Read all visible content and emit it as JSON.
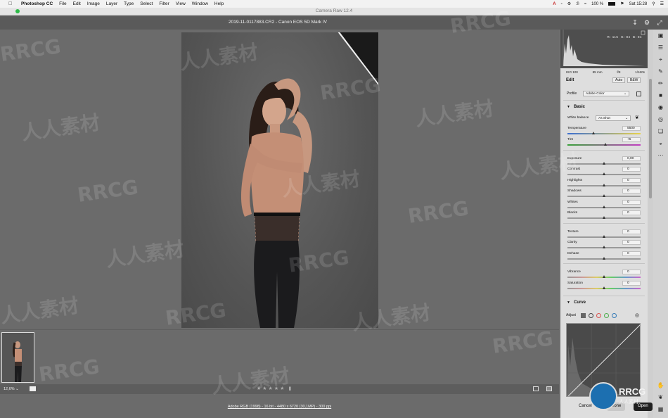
{
  "menubar": {
    "app": "Photoshop CC",
    "items": [
      "File",
      "Edit",
      "Image",
      "Layer",
      "Type",
      "Select",
      "Filter",
      "View",
      "Window",
      "Help"
    ],
    "battery": "100 %",
    "clock": "Sat 15:28"
  },
  "dialog": {
    "title": "Camera Raw 12.4"
  },
  "file_info": "2019-11-0117883.CR2  -  Canon EOS 5D Mark IV",
  "histogram": {
    "r": "R: 115",
    "g": "G: 84",
    "b": "B: 84"
  },
  "exif": [
    "ISO 100",
    "85 mm",
    "f/8",
    "1/160s"
  ],
  "edit": {
    "label": "Edit",
    "auto": "Auto",
    "bw": "B&W"
  },
  "profile": {
    "label": "Profile",
    "value": "Adobe Color"
  },
  "basic": {
    "title": "Basic",
    "white_balance_label": "White balance",
    "white_balance_value": "As Shot",
    "sliders": [
      {
        "label": "Temperature",
        "value": "5500",
        "pos": 0.36
      },
      {
        "label": "Tint",
        "value": "+5",
        "pos": 0.52
      },
      {
        "label": "Exposure",
        "value": "0,00",
        "pos": 0.5
      },
      {
        "label": "Contrast",
        "value": "0",
        "pos": 0.5
      },
      {
        "label": "Highlights",
        "value": "0",
        "pos": 0.5
      },
      {
        "label": "Shadows",
        "value": "0",
        "pos": 0.5
      },
      {
        "label": "Whites",
        "value": "0",
        "pos": 0.5
      },
      {
        "label": "Blacks",
        "value": "0",
        "pos": 0.5
      },
      {
        "label": "Texture",
        "value": "0",
        "pos": 0.5
      },
      {
        "label": "Clarity",
        "value": "0",
        "pos": 0.5
      },
      {
        "label": "Dehaze",
        "value": "0",
        "pos": 0.5
      },
      {
        "label": "Vibrance",
        "value": "0",
        "pos": 0.5
      },
      {
        "label": "Saturation",
        "value": "0",
        "pos": 0.5
      }
    ]
  },
  "curve": {
    "title": "Curve",
    "adjust_label": "Adjust"
  },
  "zoom_level": "12,6%",
  "workflow": "Adobe RGB (1998) - 16 bit - 4480 x 6720 (30,1MP) - 300 ppi",
  "actions": {
    "cancel": "Cancel",
    "done": "Done",
    "open": "Open"
  },
  "watermark": {
    "logo": "RRCG",
    "sub": "人人素材",
    "text_cn": "人人素材"
  },
  "colors": {
    "accent": "#1c6fb0",
    "panel": "#dedede",
    "canvas": "#6b6b6b"
  }
}
